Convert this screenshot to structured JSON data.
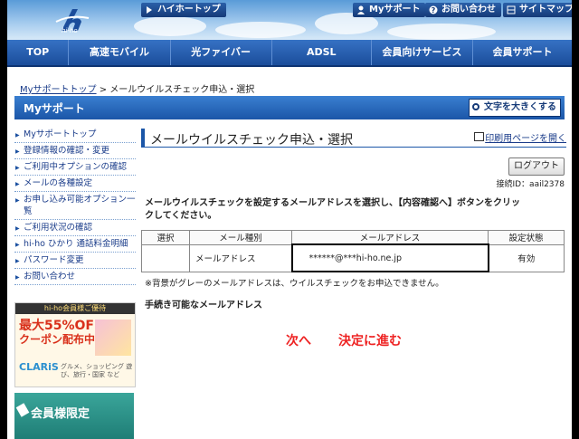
{
  "header": {
    "logo_text": "hi-ho",
    "links": [
      {
        "label": "ハイホートップ"
      },
      {
        "label": "Myサポート"
      },
      {
        "label": "お問い合わせ"
      },
      {
        "label": "サイトマップ"
      }
    ]
  },
  "nav": {
    "items": [
      {
        "label": "TOP"
      },
      {
        "label": "高速モバイル"
      },
      {
        "label": "光ファイバー"
      },
      {
        "label": "ADSL"
      },
      {
        "label": "会員向けサービス"
      },
      {
        "label": "会員サポート"
      }
    ]
  },
  "breadcrumb": {
    "home": "Myサポートトップ",
    "sep": " > ",
    "current": "メールウイルスチェック申込・選択"
  },
  "mysupport": {
    "title": "Myサポート",
    "enlarge_label": "文字を大きくする"
  },
  "sidebar": {
    "items": [
      {
        "label": "Myサポートトップ"
      },
      {
        "label": "登録情報の確認・変更"
      },
      {
        "label": "ご利用中オプションの確認"
      },
      {
        "label": "メールの各種設定"
      },
      {
        "label": "お申し込み可能オプション一覧"
      },
      {
        "label": "ご利用状況の確認"
      },
      {
        "label": "hi-ho ひかり 通話料金明細"
      },
      {
        "label": "パスワード変更"
      },
      {
        "label": "お問い合わせ"
      }
    ]
  },
  "banner1": {
    "top": "hi-ho会員様ご優待",
    "line1": "最大55%OFF",
    "line2": "クーポン配布中!!",
    "brand": "CLARiS",
    "sub": "グルメ、ショッピング 遊び、旅行・国家 など"
  },
  "banner2": {
    "label": "会員様限定"
  },
  "main": {
    "title": "メールウイルスチェック申込・選択",
    "print_label": "印刷用ページを開く",
    "logout_label": "ログアウト",
    "account": "接続ID：aail2378",
    "instruction": "メールウイルスチェックを設定するメールアドレスを選択し、【内容確認へ】ボタンをクリックしてください。",
    "table": {
      "headers": [
        "選択",
        "メール種別",
        "メールアドレス",
        "設定状態"
      ],
      "rows": [
        {
          "select": "",
          "type": "メールアドレス",
          "address": "******@***hi-ho.ne.jp",
          "status": "有効"
        }
      ]
    },
    "note": "※背景がグレーのメールアドレスは、ウイルスチェックをお申込できません。",
    "procedure_label": "手続き可能なメールアドレス",
    "next_label": "次へ",
    "decide_label": "決定に進む"
  }
}
